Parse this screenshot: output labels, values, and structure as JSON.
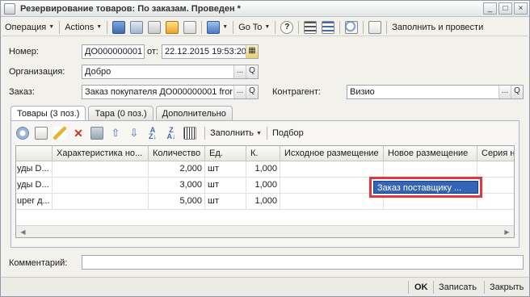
{
  "window": {
    "title": "Резервирование товаров: По заказам. Проведен *",
    "controls": [
      "_",
      "□",
      "×"
    ]
  },
  "toolbar": {
    "operation": "Операция",
    "actions": "Actions",
    "goto": "Go To",
    "help": "?",
    "fill_and_post": "Заполнить и провести"
  },
  "header": {
    "number_label": "Номер:",
    "number_value": "ДО000000001",
    "date_label": "от:",
    "date_value": "22.12.2015 19:53:20",
    "org_label": "Организация:",
    "org_value": "Добро",
    "order_label": "Заказ:",
    "order_value": "Заказ покупателя ДО000000001 fror",
    "counterparty_label": "Контрагент:",
    "counterparty_value": "Визио",
    "select_button": "...",
    "open_button": "Q"
  },
  "tabs": [
    {
      "label": "Товары (3 поз.)",
      "active": true
    },
    {
      "label": "Тара (0 поз.)",
      "active": false
    },
    {
      "label": "Дополнительно",
      "active": false
    }
  ],
  "table_toolbar": {
    "fill": "Заполнить",
    "selection": "Подбор"
  },
  "table": {
    "columns": [
      "",
      "Характеристика но...",
      "Количество",
      "Ед.",
      "К.",
      "Исходное размещение",
      "Новое размещение",
      "Серия но"
    ],
    "rows": [
      {
        "product": "уды D...",
        "characteristic": "",
        "qty": "2,000",
        "unit": "шт",
        "coef": "1,000",
        "source": "",
        "target": ""
      },
      {
        "product": "уды D...",
        "characteristic": "",
        "qty": "3,000",
        "unit": "шт",
        "coef": "1,000",
        "source": "",
        "target": "Заказ поставщику ..."
      },
      {
        "product": "uper д...",
        "characteristic": "",
        "qty": "5,000",
        "unit": "шт",
        "coef": "1,000",
        "source": "",
        "target": ""
      }
    ]
  },
  "comment_label": "Комментарий:",
  "comment_value": "",
  "footer": {
    "ok": "OK",
    "save": "Записать",
    "close": "Закрыть"
  },
  "colors": {
    "selection": "#3464b6",
    "highlight_border": "#e0383e"
  }
}
